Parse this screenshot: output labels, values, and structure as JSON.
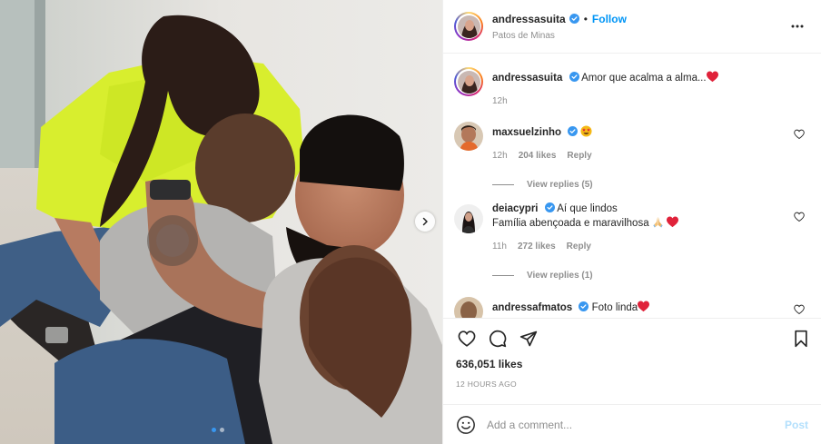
{
  "post": {
    "author": {
      "username": "andressasuita",
      "verified": true,
      "follow_label": "Follow",
      "separator": "•",
      "location": "Patos de Minas"
    },
    "more_icon": "more-horizontal-icon",
    "media": {
      "next_icon": "chevron-right-icon",
      "carousel_count": 2,
      "carousel_active": 1
    },
    "caption": {
      "username": "andressasuita",
      "text": "Amor que acalma a alma...",
      "emoji": "red-heart",
      "time": "12h"
    },
    "comments": [
      {
        "username": "maxsuelzinho",
        "verified": true,
        "text": "",
        "emoji": "star-struck-face",
        "time": "12h",
        "likes": "204 likes",
        "reply_label": "Reply",
        "view_replies": "View replies (5)"
      },
      {
        "username": "deiacypri",
        "verified": true,
        "text": "Aí que lindos",
        "text2": "Família abençoada e maravilhosa",
        "emoji2": [
          "folded-hands",
          "red-heart"
        ],
        "time": "11h",
        "likes": "272 likes",
        "reply_label": "Reply",
        "view_replies": "View replies (1)"
      },
      {
        "username": "andressafmatos",
        "verified": true,
        "text": "Foto linda",
        "emoji": "red-heart"
      }
    ],
    "likes_count": "636,051 likes",
    "time_ago": "12 HOURS AGO",
    "add_comment": {
      "placeholder": "Add a comment...",
      "post_label": "Post"
    }
  },
  "colors": {
    "accent": "#0095f6",
    "muted": "#8e8e8e",
    "heart": "#ed4956",
    "post_disabled": "#b2dffc"
  }
}
